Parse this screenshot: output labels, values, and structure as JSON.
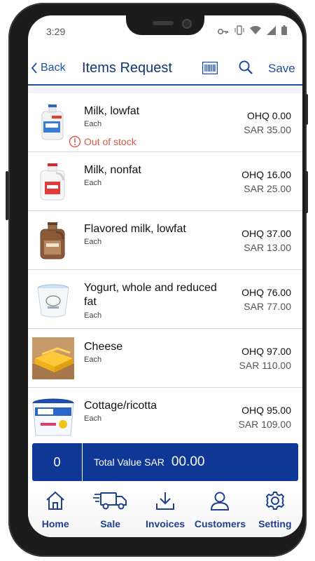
{
  "status": {
    "time": "3:29"
  },
  "header": {
    "back_label": "Back",
    "title": "Items Request",
    "save_label": "Save"
  },
  "items": [
    {
      "name": "Milk, lowfat",
      "unit": "Each",
      "ohq": "OHQ 0.00",
      "price": "SAR 35.00",
      "warning": "Out of stock"
    },
    {
      "name": "Milk, nonfat",
      "unit": "Each",
      "ohq": "OHQ 16.00",
      "price": "SAR 25.00"
    },
    {
      "name": "Flavored milk, lowfat",
      "unit": "Each",
      "ohq": "OHQ 37.00",
      "price": "SAR 13.00"
    },
    {
      "name": "Yogurt, whole and reduced fat",
      "unit": "Each",
      "ohq": "OHQ 76.00",
      "price": "SAR 77.00"
    },
    {
      "name": "Cheese",
      "unit": "Each",
      "ohq": "OHQ 97.00",
      "price": "SAR 110.00"
    },
    {
      "name": "Cottage/ricotta",
      "unit": "Each",
      "ohq": "OHQ 95.00",
      "price": "SAR 109.00"
    }
  ],
  "total": {
    "count": "0",
    "label": "Total Value SAR",
    "value": "00.00"
  },
  "nav": [
    {
      "label": "Home",
      "icon": "home-icon"
    },
    {
      "label": "Sale",
      "icon": "truck-icon"
    },
    {
      "label": "Invoices",
      "icon": "download-icon"
    },
    {
      "label": "Customers",
      "icon": "user-icon"
    },
    {
      "label": "Setting",
      "icon": "gear-icon"
    }
  ],
  "colors": {
    "primary": "#0f3896",
    "accent": "#1f4ea0",
    "warning": "#d55a4a"
  }
}
